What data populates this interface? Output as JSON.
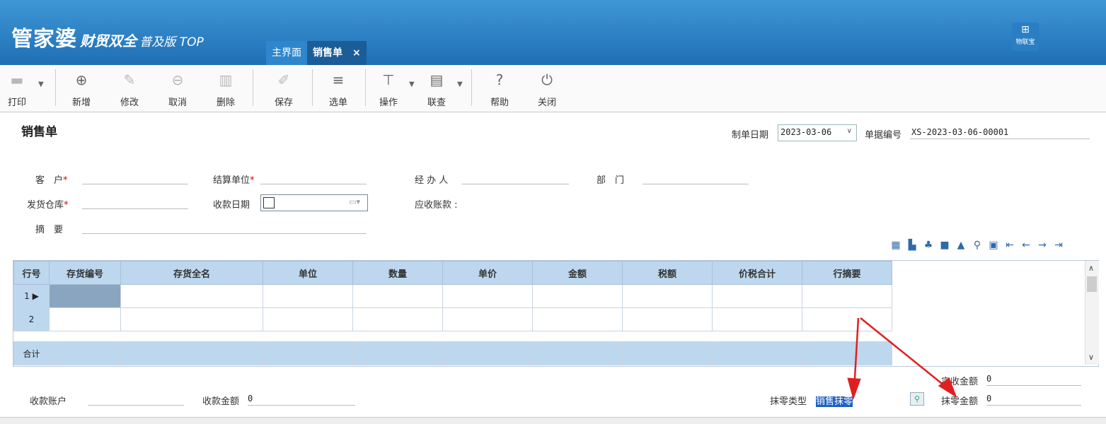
{
  "app": {
    "logo_main": "管家婆",
    "logo_sub": "财贸双全",
    "logo_edition": "普及版 TOP",
    "iot_label": "物联宝"
  },
  "tabs": [
    {
      "label": "主界面"
    },
    {
      "label": "销售单",
      "close": "×"
    }
  ],
  "toolbar": {
    "print": "打印",
    "add": "新增",
    "edit": "修改",
    "cancel": "取消",
    "delete": "删除",
    "save": "保存",
    "select_order": "选单",
    "operate": "操作",
    "link_query": "联查",
    "help": "帮助",
    "close": "关闭"
  },
  "form": {
    "title": "销售单",
    "date_label": "制单日期",
    "date_value": "2023-03-06",
    "doc_no_label": "单据编号",
    "doc_no_value": "XS-2023-03-06-00001",
    "customer_label": "客　户",
    "settle_label": "结算单位",
    "handler_label": "经 办 人",
    "dept_label": "部　门",
    "warehouse_label": "发货仓库",
    "receive_date_label": "收款日期",
    "receivable_label": "应收账款 :",
    "summary_label": "摘　要",
    "required_mark": "*"
  },
  "grid": {
    "columns": [
      "行号",
      "存货编号",
      "存货全名",
      "单位",
      "数量",
      "单价",
      "金额",
      "税额",
      "价税合计",
      "行摘要"
    ],
    "rows": [
      {
        "no": "1",
        "marker": "▶"
      },
      {
        "no": "2"
      }
    ],
    "total_label": "合计"
  },
  "footer": {
    "account_label": "收款账户",
    "recv_amount_label": "收款金额",
    "recv_amount_value": "0",
    "round_type_label": "抹零类型",
    "round_type_value": "销售抹零",
    "actual_label": "实收金额",
    "actual_value": "0",
    "round_amount_label": "抹零金额",
    "round_amount_value": "0"
  },
  "colors": {
    "header": "#2a7fc4",
    "grid_header": "#bdd7ee",
    "arrow": "#e02020"
  },
  "icons": [
    "printer-icon",
    "plus-circle-icon",
    "edit-icon",
    "minus-circle-icon",
    "trash-icon",
    "save-icon",
    "select-order-icon",
    "operate-icon",
    "link-query-icon",
    "help-icon",
    "power-icon",
    "search-icon"
  ]
}
